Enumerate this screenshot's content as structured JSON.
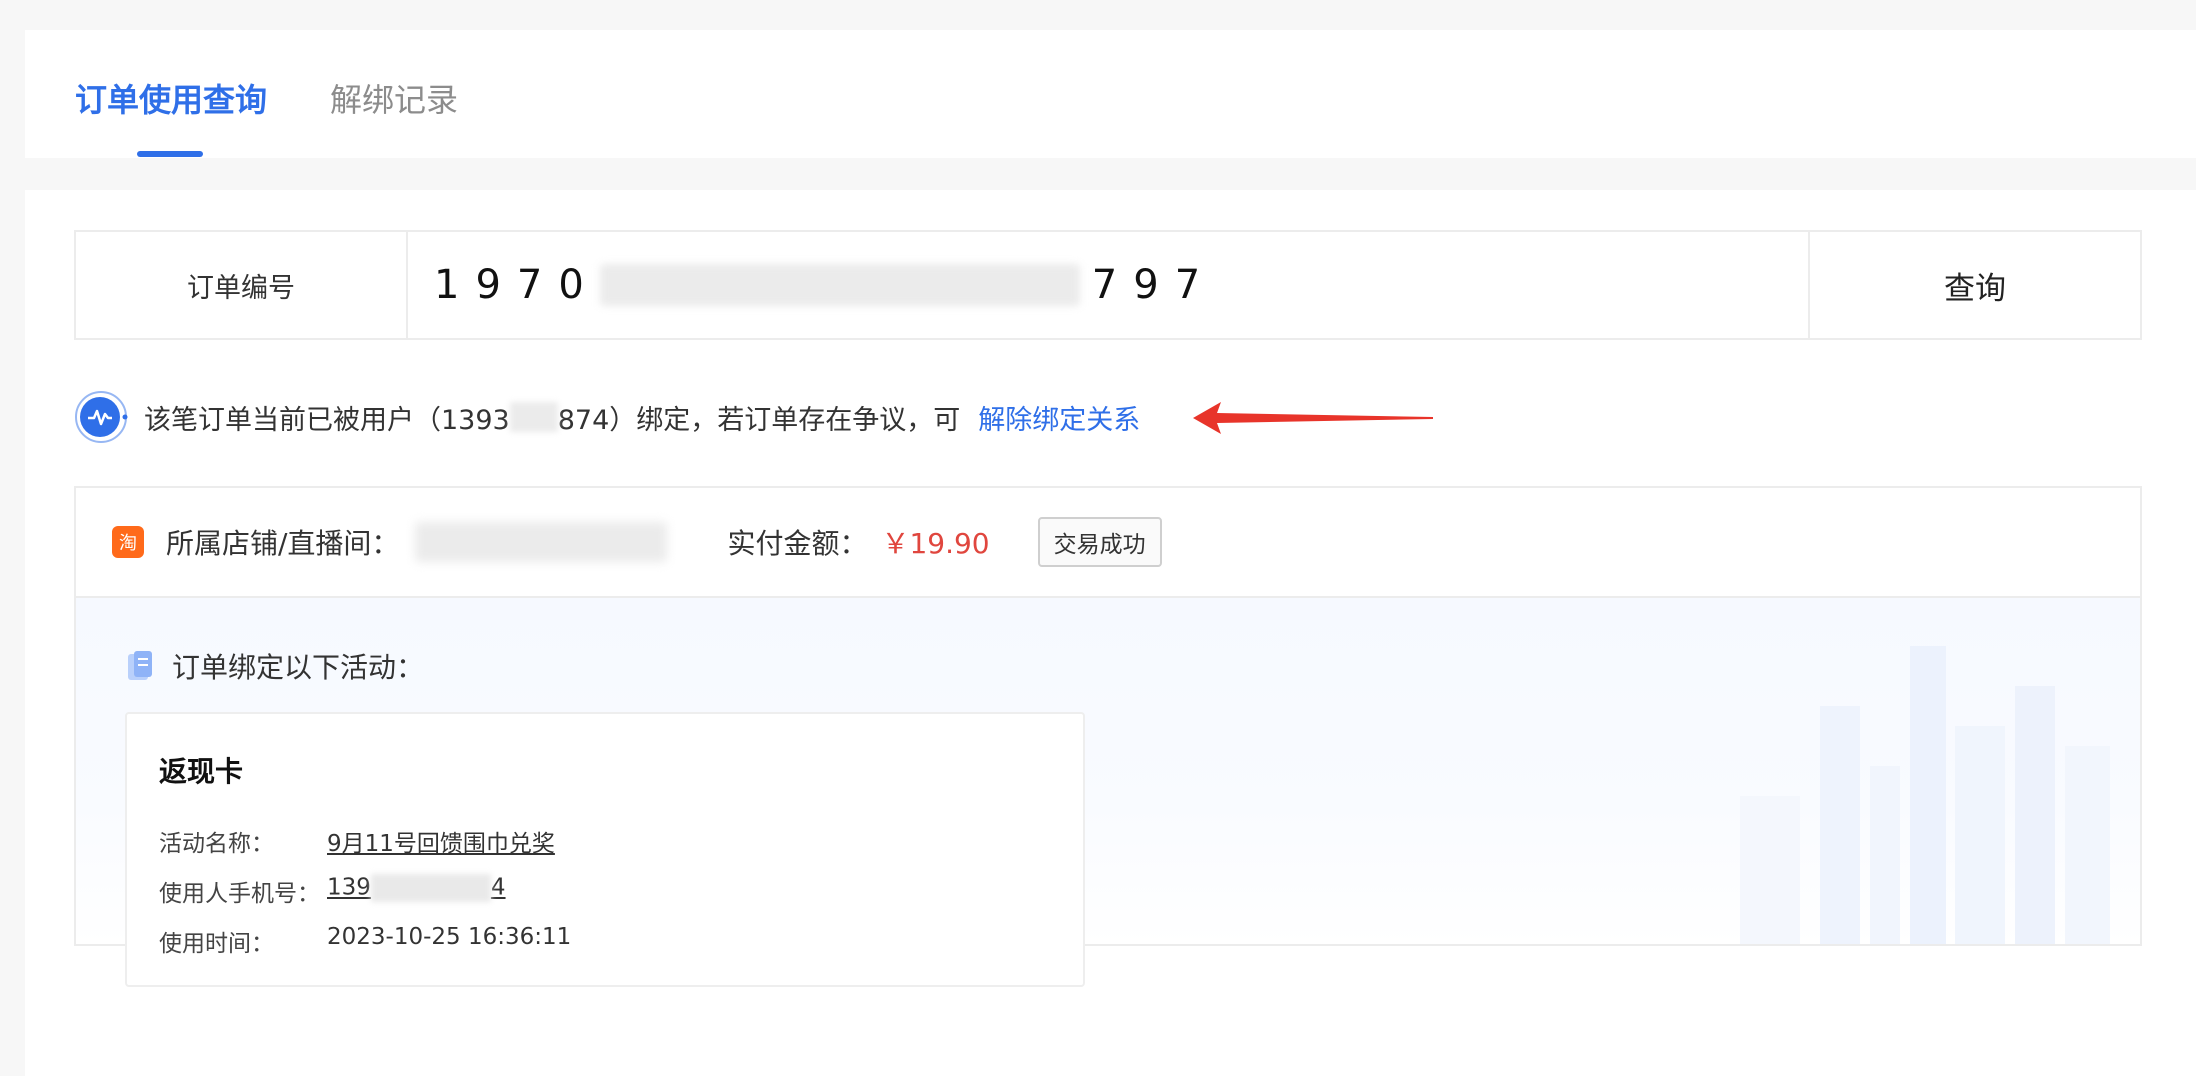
{
  "tabs": [
    {
      "label": "订单使用查询",
      "active": true
    },
    {
      "label": "解绑记录",
      "active": false
    }
  ],
  "search": {
    "label": "订单编号",
    "value_prefix": "1970",
    "value_suffix": "797",
    "button": "查询"
  },
  "notice": {
    "text_before": "该笔订单当前已被用户（1393",
    "text_after": "874）绑定，若订单存在争议，可",
    "link": "解除绑定关系"
  },
  "order": {
    "shop_label": "所属店铺/直播间：",
    "amount_label": "实付金额：",
    "amount_value": "￥19.90",
    "status": "交易成功",
    "shop_icon_text": "淘"
  },
  "binding": {
    "title": "订单绑定以下活动：",
    "card": {
      "title": "返现卡",
      "rows": [
        {
          "key": "活动名称：",
          "value": "9月11号回馈围巾兑奖"
        },
        {
          "key": "使用人手机号：",
          "value_prefix": "139",
          "value_suffix": "4"
        },
        {
          "key": "使用时间：",
          "value": "2023-10-25 16:36:11"
        }
      ]
    }
  },
  "colors": {
    "accent": "#2f6fe8",
    "price": "#e0463e",
    "arrow": "#e8342a"
  }
}
